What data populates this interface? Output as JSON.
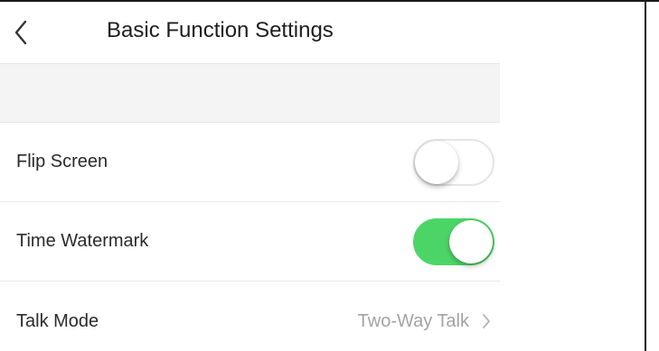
{
  "header": {
    "title": "Basic Function Settings",
    "back_icon": "chevron-left-icon"
  },
  "settings": {
    "flip_screen": {
      "label": "Flip Screen",
      "enabled": false
    },
    "time_watermark": {
      "label": "Time Watermark",
      "enabled": true
    },
    "talk_mode": {
      "label": "Talk Mode",
      "value": "Two-Way Talk",
      "icon": "chevron-right-icon"
    }
  },
  "colors": {
    "toggle_on": "#4cd567",
    "toggle_off_border": "#e4e4e4",
    "secondary_text": "#a3a3a3",
    "section_bg": "#f4f4f4"
  }
}
